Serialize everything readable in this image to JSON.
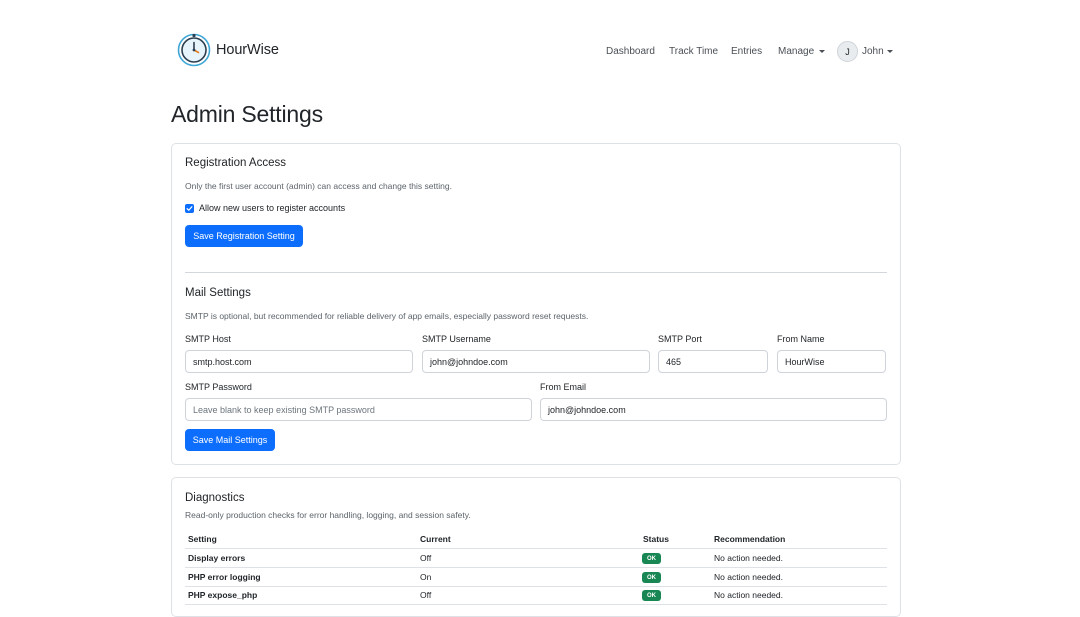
{
  "brand": {
    "name": "HourWise",
    "logo_icon": "stopwatch-icon"
  },
  "nav": {
    "dashboard": "Dashboard",
    "track_time": "Track Time",
    "entries": "Entries",
    "manage": "Manage",
    "user_initial": "J",
    "user_name": "John"
  },
  "page": {
    "title": "Admin Settings"
  },
  "registration": {
    "heading": "Registration Access",
    "description": "Only the first user account (admin) can access and change this setting.",
    "checkbox_label": "Allow new users to register accounts",
    "checkbox_checked": true,
    "save_label": "Save Registration Setting"
  },
  "mail": {
    "heading": "Mail Settings",
    "description": "SMTP is optional, but recommended for reliable delivery of app emails, especially password reset requests.",
    "smtp_host": {
      "label": "SMTP Host",
      "value": "smtp.host.com"
    },
    "smtp_username": {
      "label": "SMTP Username",
      "value": "john@johndoe.com"
    },
    "smtp_port": {
      "label": "SMTP Port",
      "value": "465"
    },
    "from_name": {
      "label": "From Name",
      "value": "HourWise"
    },
    "smtp_password": {
      "label": "SMTP Password",
      "placeholder": "Leave blank to keep existing SMTP password"
    },
    "from_email": {
      "label": "From Email",
      "value": "john@johndoe.com"
    },
    "save_label": "Save Mail Settings"
  },
  "diagnostics": {
    "heading": "Diagnostics",
    "description": "Read-only production checks for error handling, logging, and session safety.",
    "columns": [
      "Setting",
      "Current",
      "Status",
      "Recommendation"
    ],
    "rows": [
      {
        "setting": "Display errors",
        "current": "Off",
        "status": "OK",
        "recommendation": "No action needed."
      },
      {
        "setting": "PHP error logging",
        "current": "On",
        "status": "OK",
        "recommendation": "No action needed."
      },
      {
        "setting": "PHP expose_php",
        "current": "Off",
        "status": "OK",
        "recommendation": "No action needed."
      }
    ]
  },
  "colors": {
    "primary": "#0d6efd",
    "success": "#198754",
    "border": "#dee2e6",
    "muted_text": "#5c636a"
  }
}
